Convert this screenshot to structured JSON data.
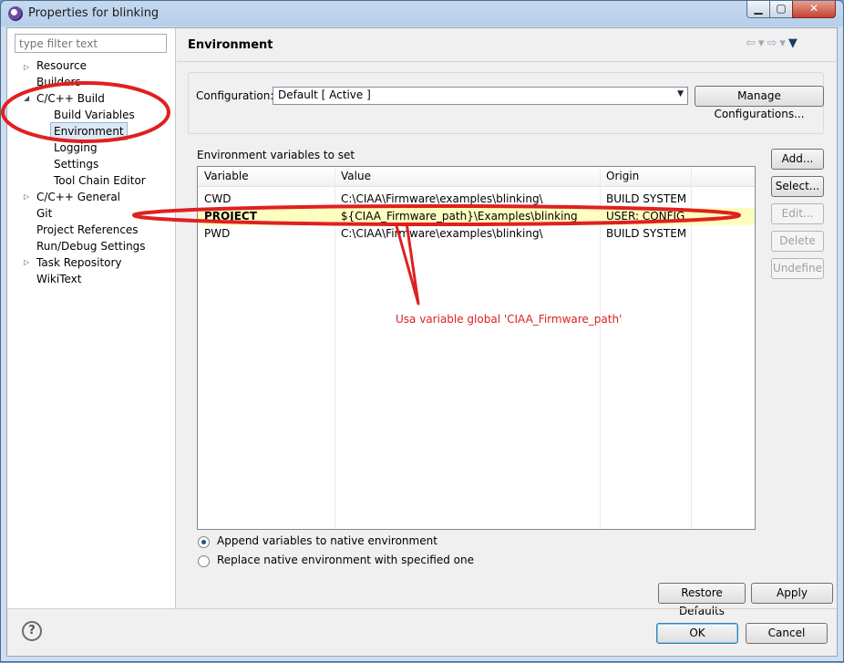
{
  "window": {
    "title": "Properties for blinking",
    "min": "▁",
    "max": "▢",
    "close": "✕"
  },
  "filter": {
    "placeholder": "type filter text"
  },
  "tree": [
    {
      "label": "Resource",
      "twisty": "▷"
    },
    {
      "label": "Builders",
      "twisty": ""
    },
    {
      "label": "C/C++ Build",
      "twisty": "◢"
    },
    {
      "label": "Build Variables",
      "twisty": ""
    },
    {
      "label": "Environment",
      "twisty": ""
    },
    {
      "label": "Logging",
      "twisty": ""
    },
    {
      "label": "Settings",
      "twisty": ""
    },
    {
      "label": "Tool Chain Editor",
      "twisty": ""
    },
    {
      "label": "C/C++ General",
      "twisty": "▷"
    },
    {
      "label": "Git",
      "twisty": ""
    },
    {
      "label": "Project References",
      "twisty": ""
    },
    {
      "label": "Run/Debug Settings",
      "twisty": ""
    },
    {
      "label": "Task Repository",
      "twisty": "▷"
    },
    {
      "label": "WikiText",
      "twisty": ""
    }
  ],
  "page": {
    "title": "Environment",
    "nav": {
      "back": "⇦",
      "forward": "⇨",
      "drop": "▾",
      "menu": "▼"
    }
  },
  "config": {
    "label": "Configuration:",
    "value": "Default  [ Active ]",
    "manage_label": "Manage Configurations..."
  },
  "env": {
    "section_label": "Environment variables to set",
    "columns": [
      "Variable",
      "Value",
      "Origin"
    ],
    "rows": [
      {
        "variable": "CWD",
        "value": "C:\\CIAA\\Firmware\\examples\\blinking\\",
        "origin": "BUILD SYSTEM"
      },
      {
        "variable": "PROJECT",
        "value": "${CIAA_Firmware_path}\\Examples\\blinking",
        "origin": "USER: CONFIG"
      },
      {
        "variable": "PWD",
        "value": "C:\\CIAA\\Firmware\\examples\\blinking\\",
        "origin": "BUILD SYSTEM"
      }
    ],
    "buttons": {
      "add": "Add...",
      "select": "Select...",
      "edit": "Edit...",
      "delete": "Delete",
      "undefine": "Undefine"
    }
  },
  "options": {
    "append": "Append variables to native environment",
    "replace": "Replace native environment with specified one",
    "selected": "append"
  },
  "actions": {
    "restore": "Restore Defaults",
    "apply": "Apply",
    "ok": "OK",
    "cancel": "Cancel",
    "help": "?"
  },
  "annotation": {
    "text": "Usa variable global 'CIAA_Firmware_path'",
    "color": "#e02020"
  }
}
